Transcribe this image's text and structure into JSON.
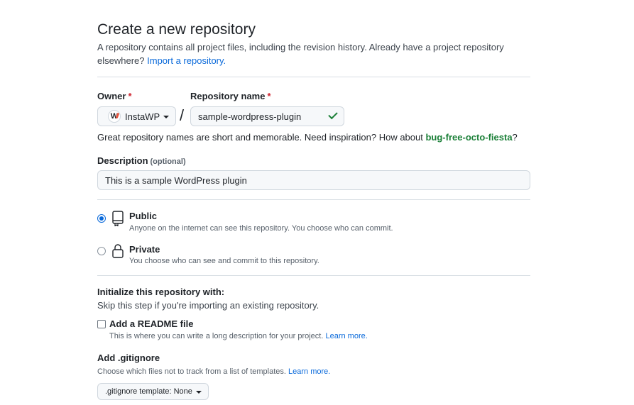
{
  "header": {
    "title": "Create a new repository",
    "subtitle": "A repository contains all project files, including the revision history. Already have a project repository elsewhere?",
    "import_link": "Import a repository."
  },
  "owner": {
    "label": "Owner",
    "required_mark": "*",
    "value": "InstaWP",
    "logo_letter": "W"
  },
  "separator": "/",
  "repo_name": {
    "label": "Repository name",
    "required_mark": "*",
    "value": "sample-wordpress-plugin",
    "valid_icon": "check-icon"
  },
  "name_hint": {
    "text": "Great repository names are short and memorable. Need inspiration? How about",
    "suggestion": "bug-free-octo-fiesta",
    "end": "?"
  },
  "description": {
    "label": "Description",
    "optional": "(optional)",
    "value": "This is a sample WordPress plugin"
  },
  "visibility": {
    "options": [
      {
        "title": "Public",
        "desc": "Anyone on the internet can see this repository. You choose who can commit.",
        "icon": "repo-icon",
        "selected": true
      },
      {
        "title": "Private",
        "desc": "You choose who can see and commit to this repository.",
        "icon": "lock-icon",
        "selected": false
      }
    ]
  },
  "init": {
    "title": "Initialize this repository with:",
    "subtitle": "Skip this step if you're importing an existing repository.",
    "readme": {
      "title": "Add a README file",
      "desc": "This is where you can write a long description for your project.",
      "link": "Learn more.",
      "checked": false
    }
  },
  "gitignore": {
    "title": "Add .gitignore",
    "desc": "Choose which files not to track from a list of templates.",
    "link": "Learn more.",
    "select_label": ".gitignore template: None"
  },
  "colors": {
    "accent": "#0969da",
    "success": "#1a7f37",
    "danger": "#cf222e",
    "border": "#d0d7de"
  }
}
